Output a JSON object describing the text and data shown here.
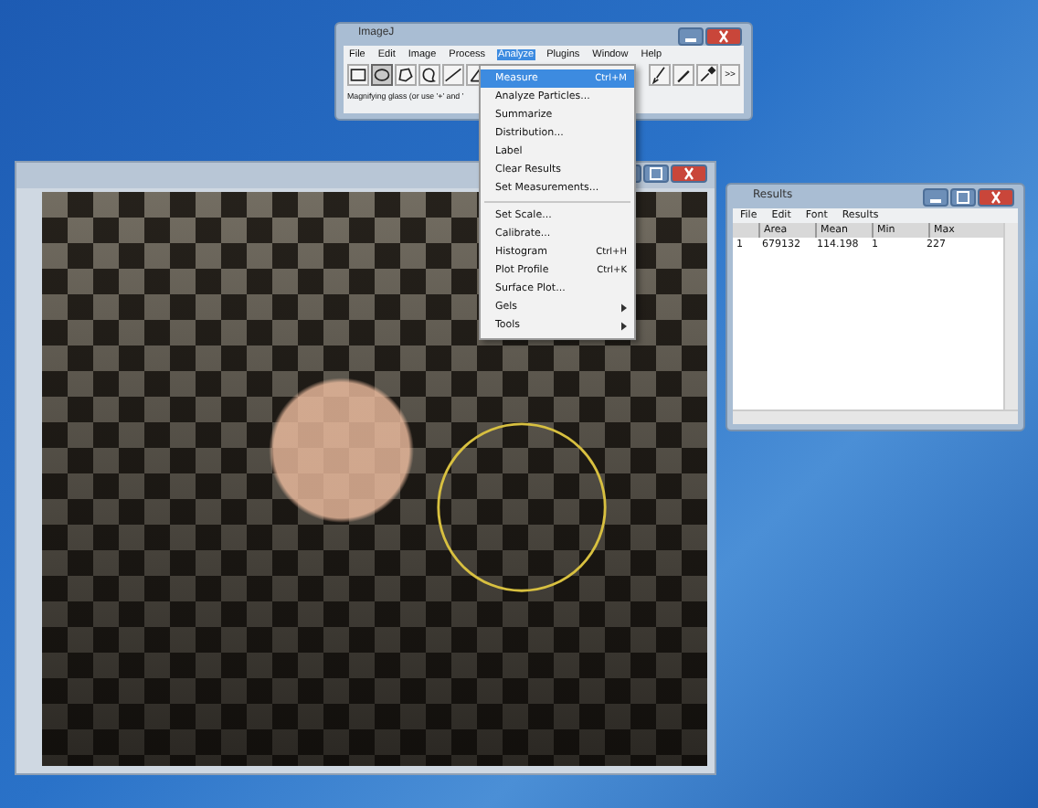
{
  "imagej_window": {
    "title": "ImageJ",
    "menu_bar": [
      {
        "label": "File",
        "selected": false
      },
      {
        "label": "Edit",
        "selected": false
      },
      {
        "label": "Image",
        "selected": false
      },
      {
        "label": "Process",
        "selected": false
      },
      {
        "label": "Analyze",
        "selected": true
      },
      {
        "label": "Plugins",
        "selected": false
      },
      {
        "label": "Window",
        "selected": false
      },
      {
        "label": "Help",
        "selected": false
      }
    ],
    "toolbar_left": [
      {
        "kind": "rect",
        "selected": false
      },
      {
        "kind": "oval",
        "selected": true
      },
      {
        "kind": "polygon",
        "selected": false
      },
      {
        "kind": "freehand",
        "selected": false
      },
      {
        "kind": "line",
        "selected": false
      },
      {
        "kind": "angle",
        "selected": false
      }
    ],
    "toolbar_right": [
      {
        "kind": "brush",
        "selected": false
      },
      {
        "kind": "pen",
        "selected": false
      },
      {
        "kind": "dropper",
        "selected": false
      }
    ],
    "more_tools": ">>",
    "status": "Magnifying glass (or use '+' and '"
  },
  "analyze_menu": [
    {
      "kind": "item",
      "label": "Measure",
      "shortcut": "Ctrl+M",
      "selected": true
    },
    {
      "kind": "item",
      "label": "Analyze Particles...",
      "selected": false
    },
    {
      "kind": "item",
      "label": "Summarize",
      "selected": false
    },
    {
      "kind": "item",
      "label": "Distribution...",
      "selected": false
    },
    {
      "kind": "item",
      "label": "Label",
      "selected": false
    },
    {
      "kind": "item",
      "label": "Clear Results",
      "selected": false
    },
    {
      "kind": "item",
      "label": "Set Measurements...",
      "selected": false
    },
    {
      "kind": "separator"
    },
    {
      "kind": "item",
      "label": "Set Scale...",
      "selected": false
    },
    {
      "kind": "item",
      "label": "Calibrate...",
      "selected": false
    },
    {
      "kind": "item",
      "label": "Histogram",
      "shortcut": "Ctrl+H",
      "selected": false
    },
    {
      "kind": "item",
      "label": "Plot Profile",
      "shortcut": "Ctrl+K",
      "selected": false
    },
    {
      "kind": "item",
      "label": "Surface Plot...",
      "selected": false
    },
    {
      "kind": "submenu",
      "label": "Gels",
      "selected": false
    },
    {
      "kind": "submenu",
      "label": "Tools",
      "selected": false
    }
  ],
  "results_window": {
    "title": "Results",
    "menu_bar": [
      "File",
      "Edit",
      "Font",
      "Results"
    ],
    "columns": [
      "Area",
      "Mean",
      "Min",
      "Max"
    ],
    "rows": [
      {
        "index": "1",
        "cells": [
          "679132",
          "114.198",
          "1",
          "227"
        ]
      }
    ]
  }
}
